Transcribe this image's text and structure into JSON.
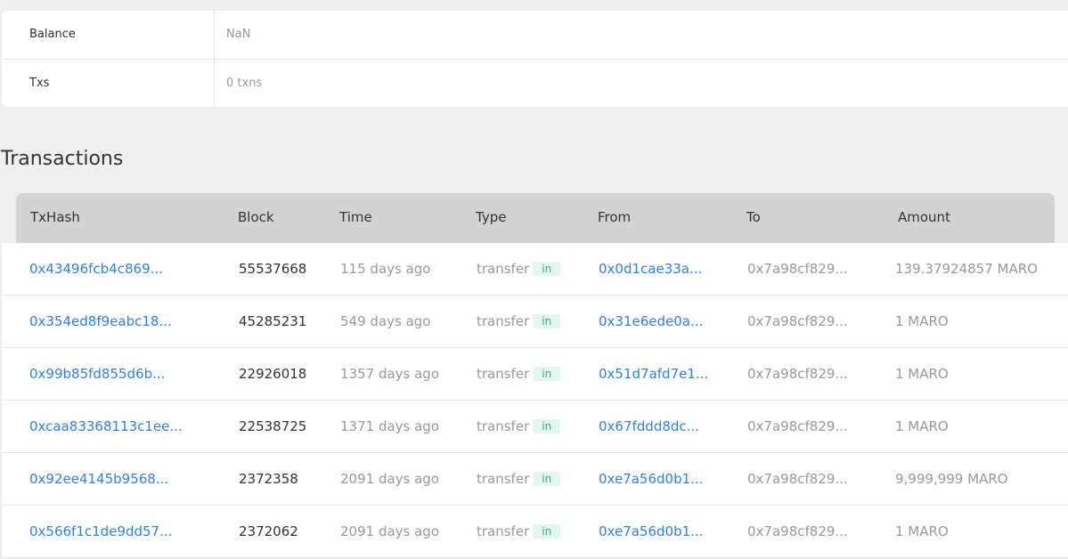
{
  "info": {
    "balance_label": "Balance",
    "balance_value": "NaN",
    "txs_label": "Txs",
    "txs_value": "0 txns"
  },
  "section_title": "Transactions",
  "table": {
    "headers": {
      "txhash": "TxHash",
      "block": "Block",
      "time": "Time",
      "type": "Type",
      "from": "From",
      "to": "To",
      "amount": "Amount"
    },
    "rows": [
      {
        "hash": "0x43496fcb4c869...",
        "block": "55537668",
        "time": "115 days ago",
        "type": "transfer",
        "dir": "in",
        "from": "0x0d1cae33a...",
        "to": "0x7a98cf829...",
        "amount": "139.37924857 MARO"
      },
      {
        "hash": "0x354ed8f9eabc18...",
        "block": "45285231",
        "time": "549 days ago",
        "type": "transfer",
        "dir": "in",
        "from": "0x31e6ede0a...",
        "to": "0x7a98cf829...",
        "amount": "1 MARO"
      },
      {
        "hash": "0x99b85fd855d6b...",
        "block": "22926018",
        "time": "1357 days ago",
        "type": "transfer",
        "dir": "in",
        "from": "0x51d7afd7e1...",
        "to": "0x7a98cf829...",
        "amount": "1 MARO"
      },
      {
        "hash": "0xcaa83368113c1ee...",
        "block": "22538725",
        "time": "1371 days ago",
        "type": "transfer",
        "dir": "in",
        "from": "0x67fddd8dc...",
        "to": "0x7a98cf829...",
        "amount": "1 MARO"
      },
      {
        "hash": "0x92ee4145b9568...",
        "block": "2372358",
        "time": "2091 days ago",
        "type": "transfer",
        "dir": "in",
        "from": "0xe7a56d0b1...",
        "to": "0x7a98cf829...",
        "amount": "9,999,999 MARO"
      },
      {
        "hash": "0x566f1c1de9dd57...",
        "block": "2372062",
        "time": "2091 days ago",
        "type": "transfer",
        "dir": "in",
        "from": "0xe7a56d0b1...",
        "to": "0x7a98cf829...",
        "amount": "1 MARO"
      }
    ]
  },
  "colors": {
    "link": "#2f80ed",
    "badge_text": "#26b77e",
    "badge_bg": "#e3f7ee",
    "header_bg": "#d3d3d3",
    "page_bg": "#efefef"
  }
}
